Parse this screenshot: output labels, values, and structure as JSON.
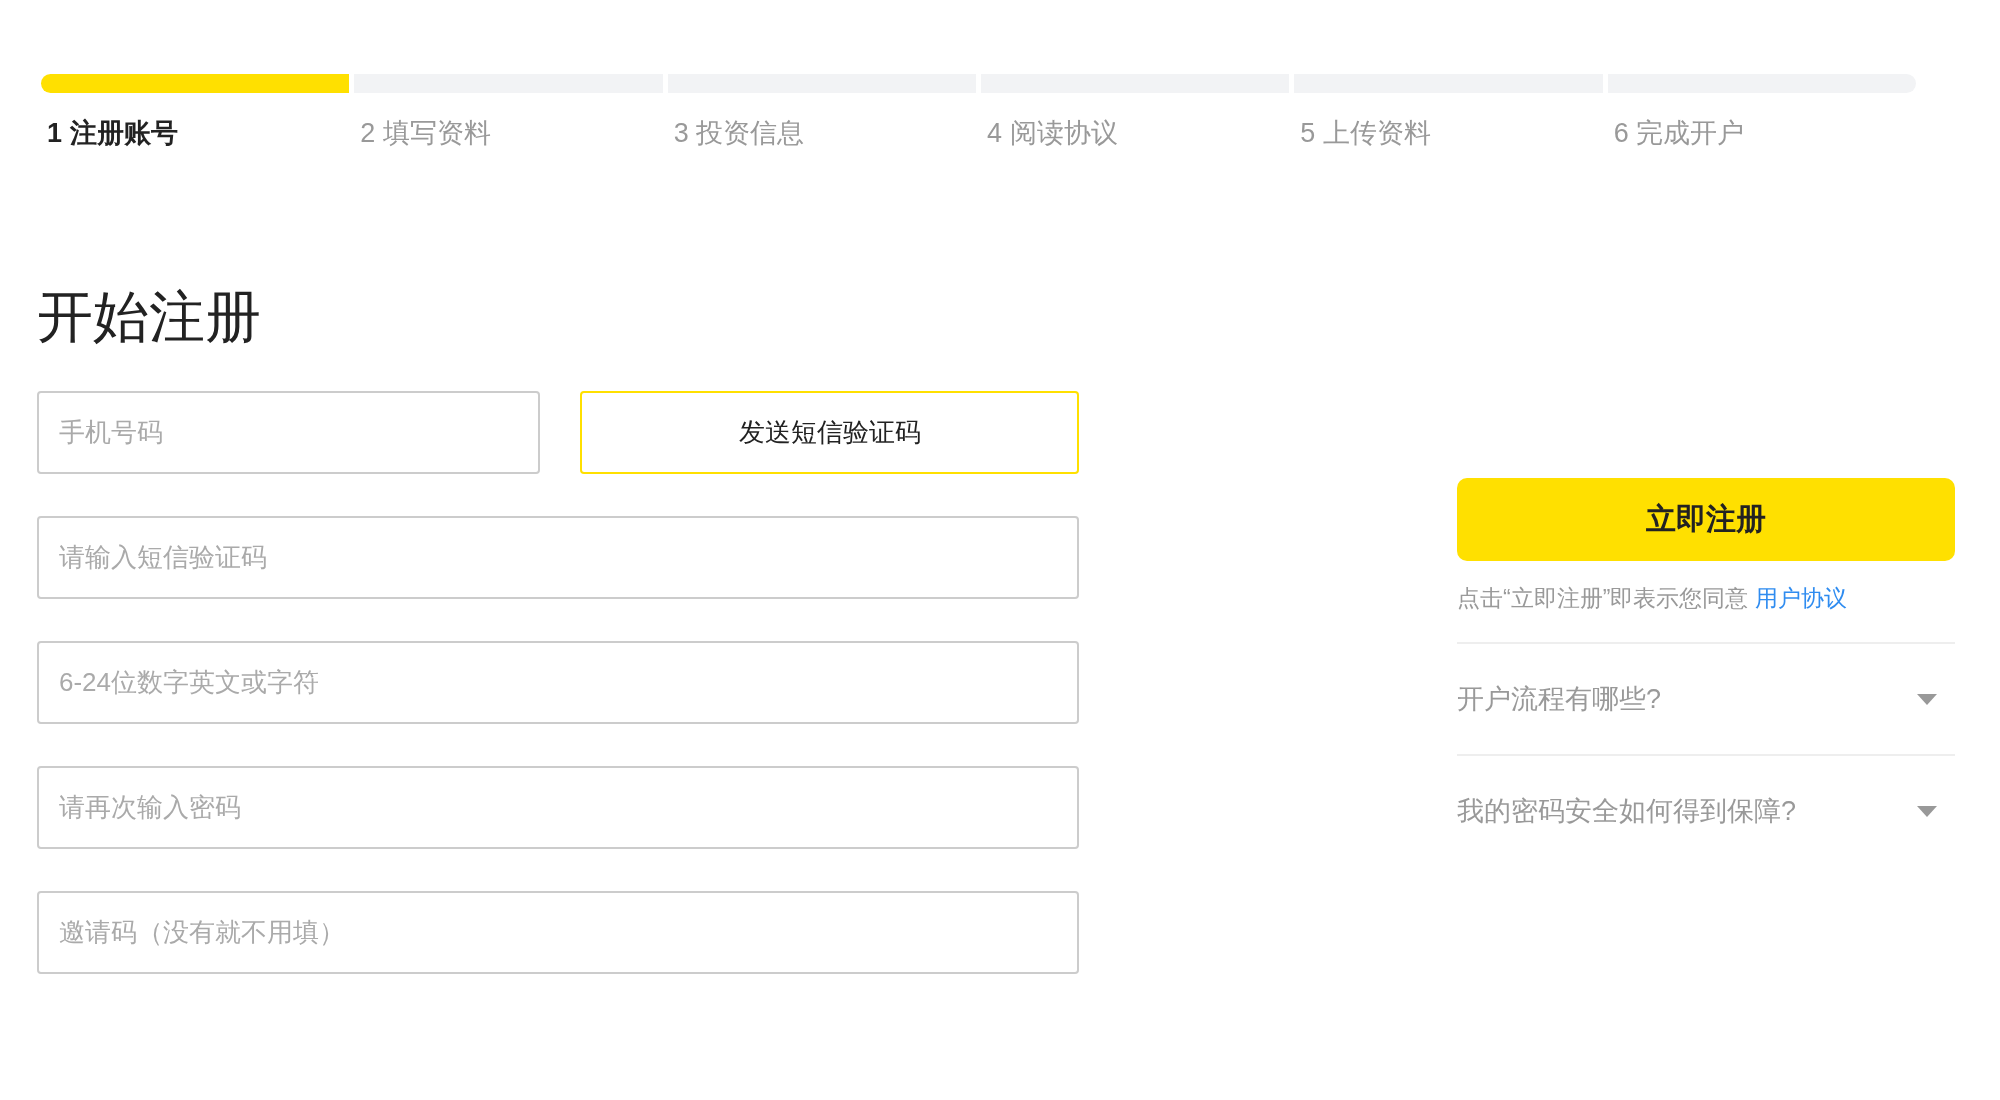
{
  "steps": [
    {
      "number": "1",
      "label": "注册账号",
      "selected": true
    },
    {
      "number": "2",
      "label": "填写资料",
      "selected": false
    },
    {
      "number": "3",
      "label": "投资信息",
      "selected": false
    },
    {
      "number": "4",
      "label": "阅读协议",
      "selected": false
    },
    {
      "number": "5",
      "label": "上传资料",
      "selected": false
    },
    {
      "number": "6",
      "label": "完成开户",
      "selected": false
    }
  ],
  "title": "开始注册",
  "form": {
    "phone": {
      "placeholder": "手机号码"
    },
    "send_code_button": "发送短信验证码",
    "fields": [
      {
        "placeholder": "请输入短信验证码"
      },
      {
        "placeholder": "6-24位数字英文或字符"
      },
      {
        "placeholder": "请再次输入密码"
      },
      {
        "placeholder": "邀请码（没有就不用填）"
      }
    ]
  },
  "sidebar": {
    "register_button": "立即注册",
    "agreement_text": "点击“立即注册”即表示您同意",
    "agreement_link": "用户协议",
    "faq": [
      {
        "question": "开户流程有哪些?",
        "expanded": false
      },
      {
        "question": "我的密码安全如何得到保障?",
        "expanded": false
      }
    ]
  }
}
